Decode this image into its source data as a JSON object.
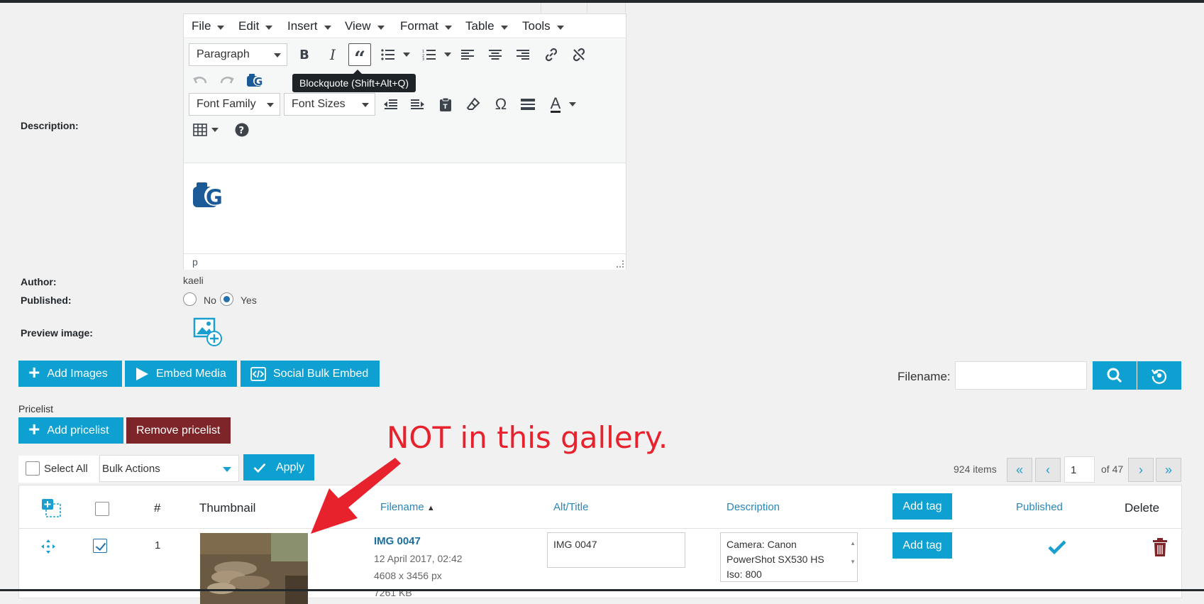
{
  "editor": {
    "menu": [
      "File",
      "Edit",
      "Insert",
      "View",
      "Format",
      "Table",
      "Tools"
    ],
    "block_format": "Paragraph",
    "font_family": "Font Family",
    "font_size": "Font Sizes",
    "tooltip": "Blockquote (Shift+Alt+Q)",
    "status_path": "p"
  },
  "form": {
    "description_label": "Description:",
    "author_label": "Author:",
    "author_value": "kaeli",
    "published_label": "Published:",
    "published_no": "No",
    "published_yes": "Yes",
    "preview_label": "Preview image:"
  },
  "actions": {
    "add_images": "Add Images",
    "embed_media": "Embed Media",
    "social_bulk_embed": "Social Bulk Embed",
    "filename_label": "Filename:",
    "pricelist_label": "Pricelist",
    "add_pricelist": "Add pricelist",
    "remove_pricelist": "Remove pricelist",
    "select_all": "Select All",
    "bulk_actions": "Bulk Actions",
    "apply": "Apply"
  },
  "pagination": {
    "items": "924 items",
    "first": "«",
    "prev": "‹",
    "page": "1",
    "of": "of 47",
    "next": "›",
    "last": "»"
  },
  "table": {
    "headers": {
      "num": "#",
      "thumbnail": "Thumbnail",
      "filename": "Filename",
      "alt": "Alt/Title",
      "description": "Description",
      "add_tag": "Add tag",
      "published": "Published",
      "delete": "Delete"
    },
    "rows": [
      {
        "num": "1",
        "filename": "IMG 0047",
        "date": "12 April 2017, 02:42",
        "dimensions": "4608 x 3456 px",
        "size": "7261 KB",
        "alt": "IMG 0047",
        "desc_line1": "Camera: Canon",
        "desc_line2": "PowerShot SX530 HS",
        "desc_line3": "Iso: 800",
        "add_tag": "Add tag"
      }
    ]
  },
  "annotation": "NOT in this gallery.",
  "colors": {
    "primary": "#0ea0d0",
    "danger": "#7e2529",
    "annotation": "#e8222c",
    "link": "#2a85b8"
  }
}
